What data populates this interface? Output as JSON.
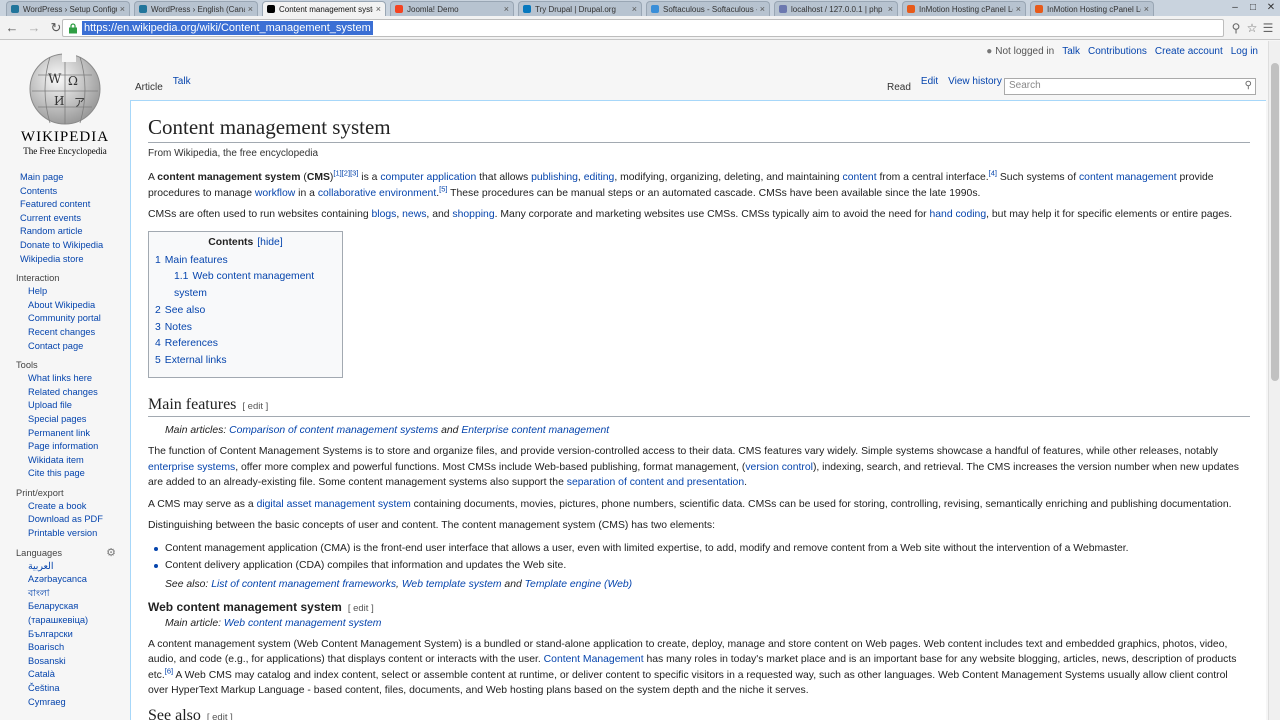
{
  "browser": {
    "tabs": [
      {
        "title": "WordPress › Setup Configu",
        "color": "#21759b"
      },
      {
        "title": "WordPress › English (Canad",
        "color": "#21759b"
      },
      {
        "title": "Content management syste",
        "color": "#000000",
        "active": true
      },
      {
        "title": "Joomla! Demo",
        "color": "#f44321"
      },
      {
        "title": "Try Drupal | Drupal.org",
        "color": "#0678be"
      },
      {
        "title": "Softaculous - Softaculous -",
        "color": "#3a8ed8"
      },
      {
        "title": "localhost / 127.0.0.1 | php",
        "color": "#6c78af"
      },
      {
        "title": "InMotion Hosting cPanel Lo",
        "color": "#e75a1a"
      },
      {
        "title": "InMotion Hosting cPanel Lo",
        "color": "#e75a1a"
      }
    ],
    "url": "https://en.wikipedia.org/wiki/Content_management_system"
  },
  "header": {
    "not_logged_in": "Not logged in",
    "talk": "Talk",
    "contributions": "Contributions",
    "create_account": "Create account",
    "log_in": "Log in"
  },
  "logo": {
    "wordmark": "WIKIPEDIA",
    "tagline": "The Free Encyclopedia"
  },
  "nav": [
    "Main page",
    "Contents",
    "Featured content",
    "Current events",
    "Random article",
    "Donate to Wikipedia",
    "Wikipedia store"
  ],
  "portals": [
    {
      "title": "Interaction",
      "items": [
        "Help",
        "About Wikipedia",
        "Community portal",
        "Recent changes",
        "Contact page"
      ]
    },
    {
      "title": "Tools",
      "items": [
        "What links here",
        "Related changes",
        "Upload file",
        "Special pages",
        "Permanent link",
        "Page information",
        "Wikidata item",
        "Cite this page"
      ]
    },
    {
      "title": "Print/export",
      "items": [
        "Create a book",
        "Download as PDF",
        "Printable version"
      ]
    },
    {
      "title": "Languages",
      "items": [
        "العربية",
        "Azərbaycanca",
        "বাংলা",
        "Беларуская (тарашкевіца)",
        "Български",
        "Boarisch",
        "Bosanski",
        "Català",
        "Čeština",
        "Cymraeg"
      ]
    }
  ],
  "tabs": {
    "article": "Article",
    "talk": "Talk",
    "read": "Read",
    "edit": "Edit",
    "history": "View history",
    "search_placeholder": "Search"
  },
  "article": {
    "title": "Content management system",
    "sitesub": "From Wikipedia, the free encyclopedia",
    "toc": {
      "title": "Contents",
      "hide": "[hide]",
      "items": [
        {
          "num": "1",
          "label": "Main features",
          "level": 1
        },
        {
          "num": "1.1",
          "label": "Web content management system",
          "level": 2
        },
        {
          "num": "2",
          "label": "See also",
          "level": 1
        },
        {
          "num": "3",
          "label": "Notes",
          "level": 1
        },
        {
          "num": "4",
          "label": "References",
          "level": 1
        },
        {
          "num": "5",
          "label": "External links",
          "level": 1
        }
      ]
    },
    "main_features": "Main features",
    "web_cms": "Web content management system",
    "see_also": "See also",
    "edit": "[ edit ]"
  }
}
